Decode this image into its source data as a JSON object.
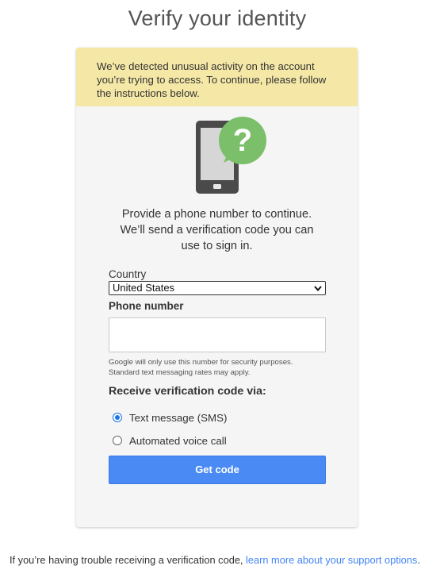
{
  "page": {
    "title": "Verify your identity"
  },
  "notice": {
    "text": "We’ve detected unusual activity on the account you’re trying to access. To continue, please follow the instructions below."
  },
  "prompt": {
    "line1": "Provide a phone number to continue.",
    "line2": "We’ll send a verification code you can",
    "line3": "use to sign in."
  },
  "country": {
    "label": "Country",
    "selected": "United States"
  },
  "phone": {
    "label": "Phone number",
    "value": "",
    "fineprint_line1": "Google will only use this number for security purposes.",
    "fineprint_line2": "Standard text messaging rates may apply."
  },
  "method": {
    "label": "Receive verification code via:",
    "options": [
      {
        "label": "Text message (SMS)",
        "selected": true
      },
      {
        "label": "Automated voice call",
        "selected": false
      }
    ]
  },
  "button": {
    "label": "Get code"
  },
  "footer": {
    "text": "If you’re having trouble receiving a verification code, ",
    "link": "learn more about your support options",
    "trailing": "."
  },
  "colors": {
    "notice_bg": "#f5e8a6",
    "card_bg": "#f5f5f5",
    "button_bg": "#4a8af4",
    "link": "#4285f4",
    "bubble_green": "#7cbf6a",
    "phone_dark": "#4a4a4a"
  },
  "icons": {
    "illustration": "phone-question-icon",
    "select_chevron": "chevron-down-icon"
  }
}
